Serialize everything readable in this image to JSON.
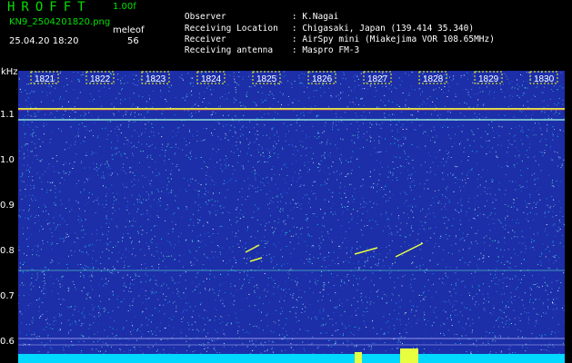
{
  "header": {
    "app_name": "HROFFT",
    "version": "1.00f",
    "file_name": "KN9_2504201820.png",
    "datetime": "25.04.20 18:20",
    "mode_label": "meleof",
    "mode_value": "56"
  },
  "station_info": [
    {
      "label": "Observer",
      "value": ": K.Nagai"
    },
    {
      "label": "Receiving Location",
      "value": ": Chigasaki, Japan (139.414 35.340)"
    },
    {
      "label": "Receiver",
      "value": ": AirSpy mini (Miakejima VOR 108.65MHz)"
    },
    {
      "label": "Receiving antenna",
      "value": ": Maspro FM-3"
    }
  ],
  "spectrogram": {
    "y_unit": "kHz",
    "y_ticks": [
      "1.1",
      "1.0",
      "0.9",
      "0.8",
      "0.7",
      "0.6"
    ],
    "time_ticks": [
      "1821",
      "1822",
      "1823",
      "1824",
      "1825",
      "1826",
      "1827",
      "1828",
      "1829",
      "1830"
    ],
    "colors": {
      "background": "#1c2ea8",
      "noise": "#00d8ff",
      "signal": "#e8ff40",
      "carrier": "#ff5050",
      "label_box": "#ffff00"
    }
  }
}
